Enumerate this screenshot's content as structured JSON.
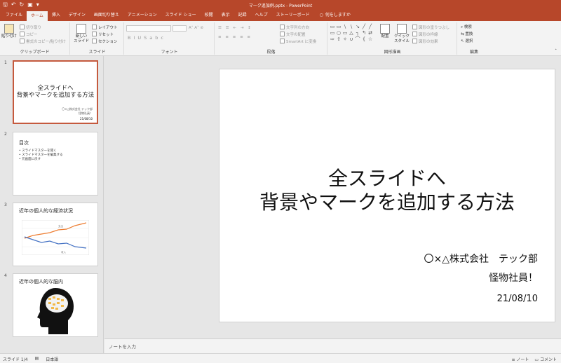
{
  "titlebar": {
    "doc_title": "マーク追加例.pptx - PowerPoint",
    "save_icon": "save-icon",
    "undo_icon": "undo-icon",
    "redo_icon": "redo-icon"
  },
  "tabs": [
    "ファイル",
    "ホーム",
    "挿入",
    "デザイン",
    "画面切り替え",
    "アニメーション",
    "スライド ショー",
    "校閲",
    "表示",
    "記録",
    "ヘルプ",
    "ストーリーボード"
  ],
  "tell_me": "何をしますか",
  "ribbon": {
    "clipboard": {
      "paste": "貼り付け",
      "cut": "切り取り",
      "copy": "コピー",
      "format_painter": "書式のコピー/貼り付け",
      "label": "クリップボード"
    },
    "slides": {
      "new_slide": "新しい",
      "new_slide2": "スライド",
      "layout": "レイアウト",
      "reset": "リセット",
      "section": "セクション",
      "label": "スライド"
    },
    "font": {
      "label": "フォント",
      "bold": "B",
      "italic": "I",
      "underline": "U",
      "shadow": "S",
      "strike": "abc"
    },
    "paragraph": {
      "text_direction": "文字列の方向",
      "align_text": "文字の配置",
      "smartart": "SmartArt に変換",
      "label": "段落"
    },
    "drawing": {
      "arrange": "配置",
      "quick_styles": "クイック",
      "quick_styles2": "スタイル",
      "shape_fill": "図形の塗りつぶし",
      "shape_outline": "図形の枠線",
      "shape_effects": "図形の効果",
      "label": "図形描画"
    },
    "editing": {
      "find": "検索",
      "replace": "置換",
      "select": "選択",
      "label": "編集"
    }
  },
  "thumbnails": [
    {
      "num": "1",
      "title_line1": "全スライドへ",
      "title_line2": "背景やマークを追加する方法",
      "sub1": "〇×△株式会社 テック部",
      "sub2": "怪物社員！",
      "date": "21/08/10"
    },
    {
      "num": "2",
      "title": "目次",
      "items": [
        "スライドマスターを開く",
        "スライドマスターを編集する",
        "元画面に戻す"
      ]
    },
    {
      "num": "3",
      "title": "近年の個人的な経済状況",
      "chart_label_top": "支出",
      "chart_label_bottom": "収入"
    },
    {
      "num": "4",
      "title": "近年の個人的な脳内"
    }
  ],
  "slide": {
    "title_line1": "全スライドへ",
    "title_line2": "背景やマークを追加する方法",
    "company": "〇×△株式会社　テック部",
    "name": "怪物社員！",
    "date": "21/08/10"
  },
  "notes_placeholder": "ノートを入力",
  "status": {
    "slide_pos": "スライド 1/4",
    "language": "日本語",
    "notes": "ノート",
    "comments": "コメント"
  }
}
